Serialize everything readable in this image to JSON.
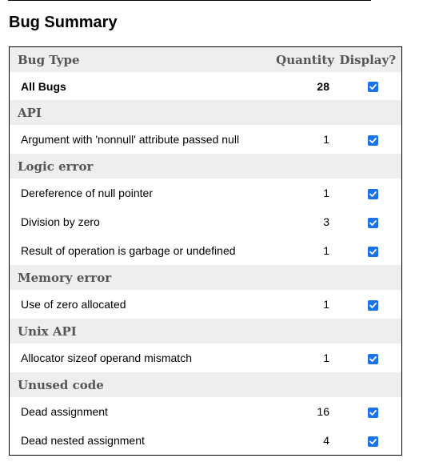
{
  "page": {
    "title": "Bug Summary"
  },
  "table": {
    "headers": {
      "bug_type": "Bug Type",
      "quantity": "Quantity",
      "display": "Display?"
    },
    "all_bugs": {
      "label": "All Bugs",
      "quantity": "28",
      "display_checked": true
    },
    "categories": [
      {
        "name": "API",
        "bugs": [
          {
            "label": "Argument with 'nonnull' attribute passed null",
            "quantity": "1",
            "checked": true
          }
        ]
      },
      {
        "name": "Logic error",
        "bugs": [
          {
            "label": "Dereference of null pointer",
            "quantity": "1",
            "checked": true
          },
          {
            "label": "Division by zero",
            "quantity": "3",
            "checked": true
          },
          {
            "label": "Result of operation is garbage or undefined",
            "quantity": "1",
            "checked": true
          }
        ]
      },
      {
        "name": "Memory error",
        "bugs": [
          {
            "label": "Use of zero allocated",
            "quantity": "1",
            "checked": true
          }
        ]
      },
      {
        "name": "Unix API",
        "bugs": [
          {
            "label": "Allocator sizeof operand mismatch",
            "quantity": "1",
            "checked": true
          }
        ]
      },
      {
        "name": "Unused code",
        "bugs": [
          {
            "label": "Dead assignment",
            "quantity": "16",
            "checked": true
          },
          {
            "label": "Dead nested assignment",
            "quantity": "4",
            "checked": true
          }
        ]
      }
    ]
  },
  "colors": {
    "checkbox_accent": "#1a73e8",
    "header_bg": "#eeeeee",
    "header_text": "#555555"
  },
  "icons": {
    "checkbox": "checkbox-checked-icon"
  }
}
